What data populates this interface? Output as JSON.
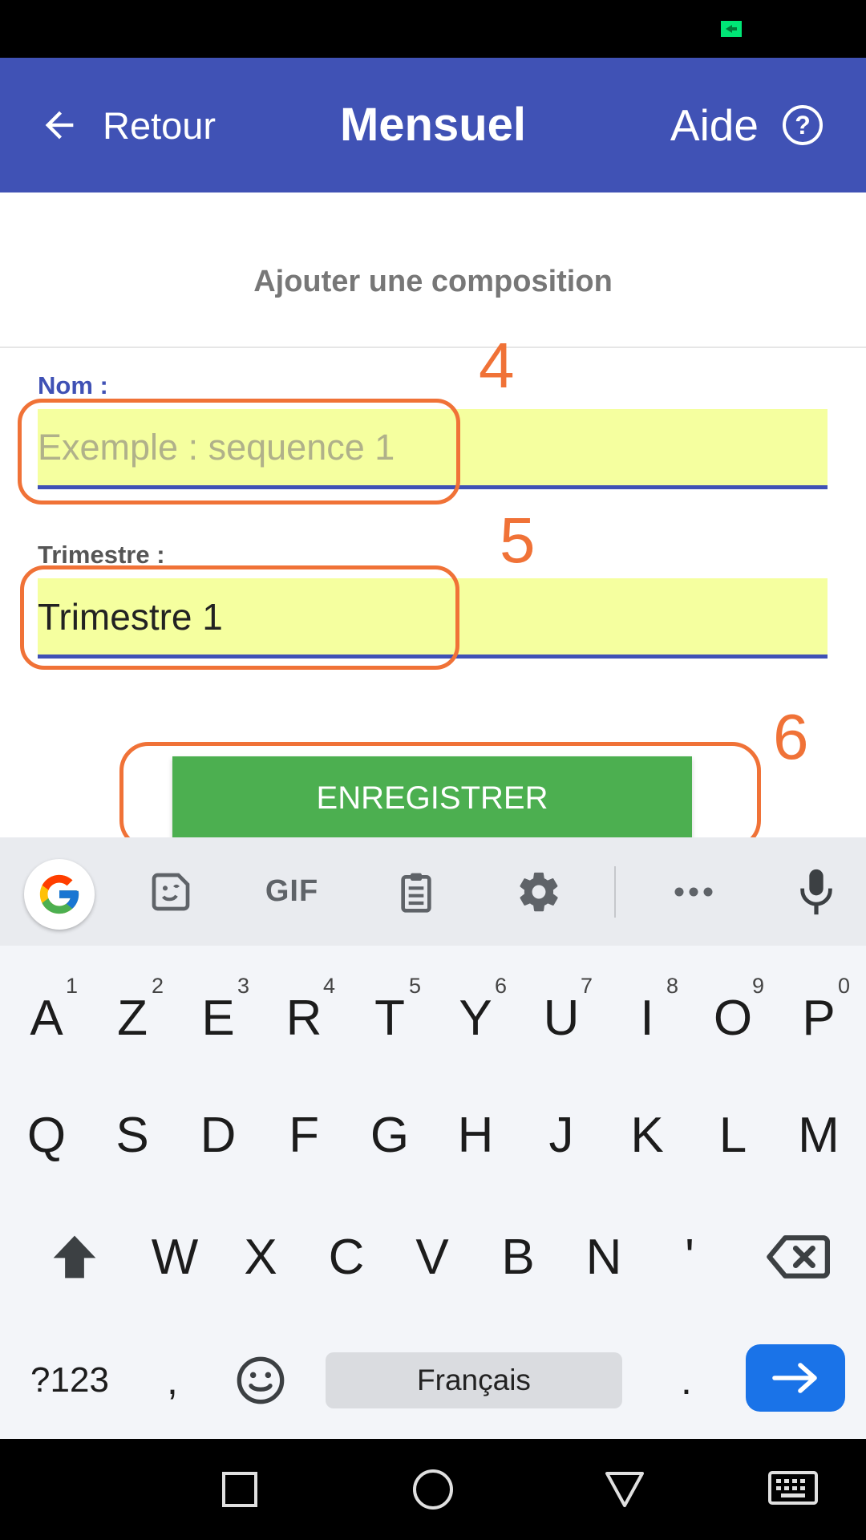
{
  "app_bar": {
    "back_label": "Retour",
    "title": "Mensuel",
    "help_label": "Aide",
    "background": "#4052b5"
  },
  "form": {
    "heading": "Ajouter une composition",
    "name_label": "Nom :",
    "name_placeholder": "Exemple : sequence 1",
    "name_value": "",
    "quarter_label": "Trimestre :",
    "quarter_value": "Trimestre 1",
    "save_label": "ENREGISTRER",
    "field_background": "#f5ff9f",
    "save_color": "#4caf50"
  },
  "annotations": {
    "color": "#f07237",
    "labels": [
      "4",
      "5",
      "6"
    ]
  },
  "keyboard": {
    "toolbar_icons": [
      "google-icon",
      "sticker-icon",
      "gif-icon",
      "clipboard-icon",
      "settings-icon",
      "more-icon",
      "microphone-icon"
    ],
    "toolbar_gif_label": "GIF",
    "row1": [
      {
        "key": "A",
        "hint": "1"
      },
      {
        "key": "Z",
        "hint": "2"
      },
      {
        "key": "E",
        "hint": "3"
      },
      {
        "key": "R",
        "hint": "4"
      },
      {
        "key": "T",
        "hint": "5"
      },
      {
        "key": "Y",
        "hint": "6"
      },
      {
        "key": "U",
        "hint": "7"
      },
      {
        "key": "I",
        "hint": "8"
      },
      {
        "key": "O",
        "hint": "9"
      },
      {
        "key": "P",
        "hint": "0"
      }
    ],
    "row2": [
      "Q",
      "S",
      "D",
      "F",
      "G",
      "H",
      "J",
      "K",
      "L",
      "M"
    ],
    "row3": [
      "W",
      "X",
      "C",
      "V",
      "B",
      "N",
      "'"
    ],
    "symbols_label": "?123",
    "comma": ",",
    "space_label": "Français",
    "period": ".",
    "enter_color": "#1a73e8"
  },
  "status_bar": {
    "indicator_color": "#00e676"
  }
}
